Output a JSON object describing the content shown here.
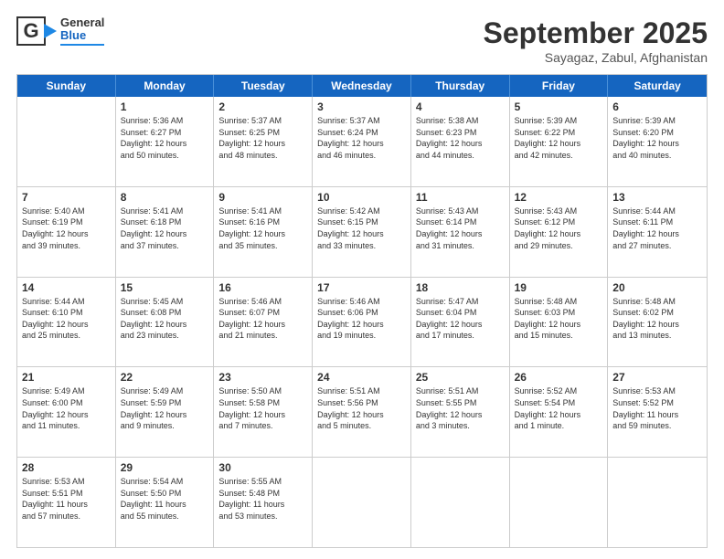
{
  "header": {
    "logo": {
      "letter": "G",
      "line1": "General",
      "line2": "Blue"
    },
    "title": "September 2025",
    "subtitle": "Sayagaz, Zabul, Afghanistan"
  },
  "calendar": {
    "days_of_week": [
      "Sunday",
      "Monday",
      "Tuesday",
      "Wednesday",
      "Thursday",
      "Friday",
      "Saturday"
    ],
    "weeks": [
      [
        {
          "day": "",
          "info": ""
        },
        {
          "day": "1",
          "info": "Sunrise: 5:36 AM\nSunset: 6:27 PM\nDaylight: 12 hours\nand 50 minutes."
        },
        {
          "day": "2",
          "info": "Sunrise: 5:37 AM\nSunset: 6:25 PM\nDaylight: 12 hours\nand 48 minutes."
        },
        {
          "day": "3",
          "info": "Sunrise: 5:37 AM\nSunset: 6:24 PM\nDaylight: 12 hours\nand 46 minutes."
        },
        {
          "day": "4",
          "info": "Sunrise: 5:38 AM\nSunset: 6:23 PM\nDaylight: 12 hours\nand 44 minutes."
        },
        {
          "day": "5",
          "info": "Sunrise: 5:39 AM\nSunset: 6:22 PM\nDaylight: 12 hours\nand 42 minutes."
        },
        {
          "day": "6",
          "info": "Sunrise: 5:39 AM\nSunset: 6:20 PM\nDaylight: 12 hours\nand 40 minutes."
        }
      ],
      [
        {
          "day": "7",
          "info": "Sunrise: 5:40 AM\nSunset: 6:19 PM\nDaylight: 12 hours\nand 39 minutes."
        },
        {
          "day": "8",
          "info": "Sunrise: 5:41 AM\nSunset: 6:18 PM\nDaylight: 12 hours\nand 37 minutes."
        },
        {
          "day": "9",
          "info": "Sunrise: 5:41 AM\nSunset: 6:16 PM\nDaylight: 12 hours\nand 35 minutes."
        },
        {
          "day": "10",
          "info": "Sunrise: 5:42 AM\nSunset: 6:15 PM\nDaylight: 12 hours\nand 33 minutes."
        },
        {
          "day": "11",
          "info": "Sunrise: 5:43 AM\nSunset: 6:14 PM\nDaylight: 12 hours\nand 31 minutes."
        },
        {
          "day": "12",
          "info": "Sunrise: 5:43 AM\nSunset: 6:12 PM\nDaylight: 12 hours\nand 29 minutes."
        },
        {
          "day": "13",
          "info": "Sunrise: 5:44 AM\nSunset: 6:11 PM\nDaylight: 12 hours\nand 27 minutes."
        }
      ],
      [
        {
          "day": "14",
          "info": "Sunrise: 5:44 AM\nSunset: 6:10 PM\nDaylight: 12 hours\nand 25 minutes."
        },
        {
          "day": "15",
          "info": "Sunrise: 5:45 AM\nSunset: 6:08 PM\nDaylight: 12 hours\nand 23 minutes."
        },
        {
          "day": "16",
          "info": "Sunrise: 5:46 AM\nSunset: 6:07 PM\nDaylight: 12 hours\nand 21 minutes."
        },
        {
          "day": "17",
          "info": "Sunrise: 5:46 AM\nSunset: 6:06 PM\nDaylight: 12 hours\nand 19 minutes."
        },
        {
          "day": "18",
          "info": "Sunrise: 5:47 AM\nSunset: 6:04 PM\nDaylight: 12 hours\nand 17 minutes."
        },
        {
          "day": "19",
          "info": "Sunrise: 5:48 AM\nSunset: 6:03 PM\nDaylight: 12 hours\nand 15 minutes."
        },
        {
          "day": "20",
          "info": "Sunrise: 5:48 AM\nSunset: 6:02 PM\nDaylight: 12 hours\nand 13 minutes."
        }
      ],
      [
        {
          "day": "21",
          "info": "Sunrise: 5:49 AM\nSunset: 6:00 PM\nDaylight: 12 hours\nand 11 minutes."
        },
        {
          "day": "22",
          "info": "Sunrise: 5:49 AM\nSunset: 5:59 PM\nDaylight: 12 hours\nand 9 minutes."
        },
        {
          "day": "23",
          "info": "Sunrise: 5:50 AM\nSunset: 5:58 PM\nDaylight: 12 hours\nand 7 minutes."
        },
        {
          "day": "24",
          "info": "Sunrise: 5:51 AM\nSunset: 5:56 PM\nDaylight: 12 hours\nand 5 minutes."
        },
        {
          "day": "25",
          "info": "Sunrise: 5:51 AM\nSunset: 5:55 PM\nDaylight: 12 hours\nand 3 minutes."
        },
        {
          "day": "26",
          "info": "Sunrise: 5:52 AM\nSunset: 5:54 PM\nDaylight: 12 hours\nand 1 minute."
        },
        {
          "day": "27",
          "info": "Sunrise: 5:53 AM\nSunset: 5:52 PM\nDaylight: 11 hours\nand 59 minutes."
        }
      ],
      [
        {
          "day": "28",
          "info": "Sunrise: 5:53 AM\nSunset: 5:51 PM\nDaylight: 11 hours\nand 57 minutes."
        },
        {
          "day": "29",
          "info": "Sunrise: 5:54 AM\nSunset: 5:50 PM\nDaylight: 11 hours\nand 55 minutes."
        },
        {
          "day": "30",
          "info": "Sunrise: 5:55 AM\nSunset: 5:48 PM\nDaylight: 11 hours\nand 53 minutes."
        },
        {
          "day": "",
          "info": ""
        },
        {
          "day": "",
          "info": ""
        },
        {
          "day": "",
          "info": ""
        },
        {
          "day": "",
          "info": ""
        }
      ]
    ]
  }
}
